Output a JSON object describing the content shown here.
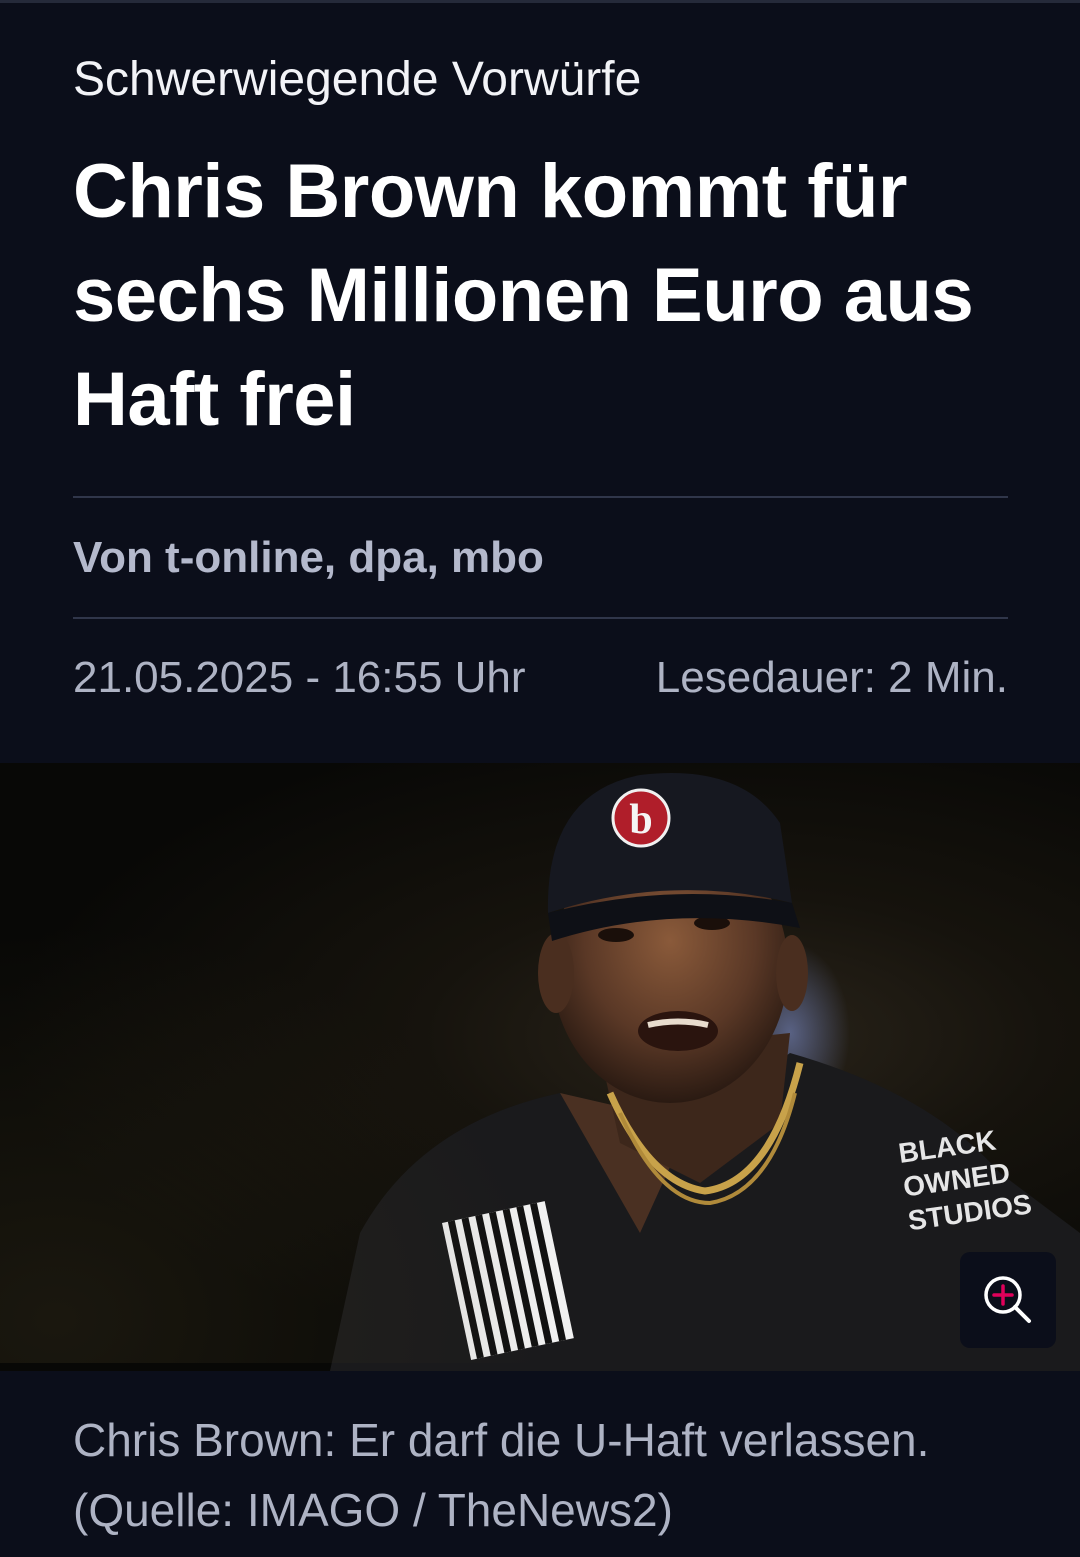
{
  "article": {
    "kicker": "Schwerwiegende Vorwürfe",
    "title": "Chris Brown kommt für sechs Millionen Euro aus Haft frei",
    "author": "Von t-online, dpa, mbo",
    "date": "21.05.2025 - 16:55 Uhr",
    "reading_time": "Lesedauer: 2 Min."
  },
  "image": {
    "description_icon": "photo-person-icon",
    "zoom_icon": "zoom-in-icon",
    "caption": "Chris Brown: Er darf die U-Haft verlassen. (Quelle: IMAGO / TheNews2)",
    "cap_logo": "b",
    "shirt_text": "BLACK OWNED STUDIOS"
  },
  "colors": {
    "background": "#0b0e1a",
    "accent": "#e0005a",
    "text_primary": "#ffffff",
    "text_secondary": "#aeb3c4"
  }
}
